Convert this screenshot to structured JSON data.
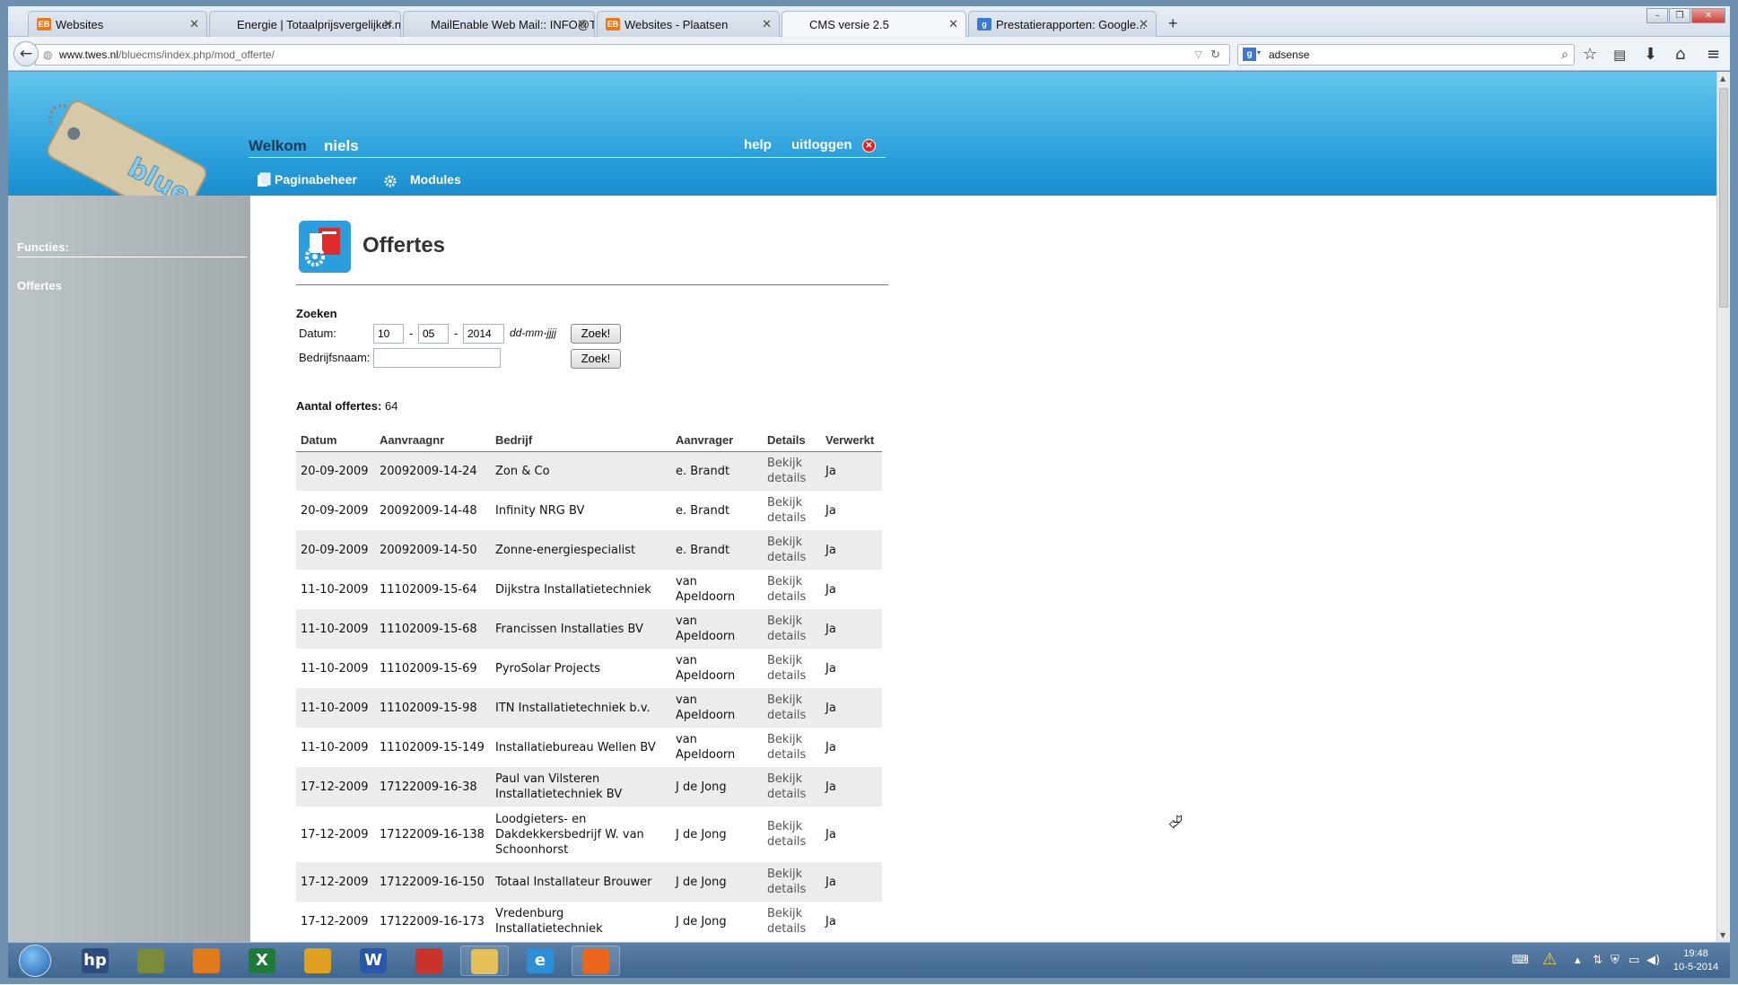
{
  "browser": {
    "tabs": [
      {
        "label": "Websites",
        "fav": "EB",
        "fav_color": "#e87a1d"
      },
      {
        "label": "Energie | Totaalprijsvergelijker.nl",
        "fav": "",
        "fav_color": ""
      },
      {
        "label": "MailEnable Web Mail:: INFO@T...",
        "fav": "",
        "fav_color": ""
      },
      {
        "label": "Websites - Plaatsen",
        "fav": "EB",
        "fav_color": "#e87a1d"
      },
      {
        "label": "CMS versie 2.5",
        "fav": "",
        "fav_color": ""
      },
      {
        "label": "Prestatierapporten: Google...",
        "fav": "g",
        "fav_color": "#3b79d7"
      }
    ],
    "new_tab_label": "+",
    "url_host": "www.twes.nl",
    "url_path": "/bluecms/index.php/mod_offerte/",
    "search_value": "adsense"
  },
  "header": {
    "welcome": "Welkom",
    "user": "niels",
    "help": "help",
    "logout": "uitloggen",
    "nav": [
      "Paginabeheer",
      "Modules"
    ]
  },
  "sidebar": {
    "heading": "Functies:",
    "items": [
      "Offertes"
    ]
  },
  "main": {
    "title": "Offertes",
    "search": {
      "heading": "Zoeken",
      "date_label": "Datum:",
      "day": "10",
      "month": "05",
      "year": "2014",
      "sep": "-",
      "format_hint": "dd-mm-jjjj",
      "button": "Zoek!",
      "company_label": "Bedrijfsnaam:",
      "company_value": ""
    },
    "count_label": "Aantal offertes:",
    "count_value": "64",
    "columns": [
      "Datum",
      "Aanvraagnr",
      "Bedrijf",
      "Aanvrager",
      "Details",
      "Verwerkt"
    ],
    "rows": [
      {
        "datum": "20-09-2009",
        "nr": "20092009-14-24",
        "bedrijf": "Zon & Co",
        "aanvrager": "e. Brandt",
        "details": "Bekijk details",
        "verwerkt": "Ja"
      },
      {
        "datum": "20-09-2009",
        "nr": "20092009-14-48",
        "bedrijf": "Infinity NRG BV",
        "aanvrager": "e. Brandt",
        "details": "Bekijk details",
        "verwerkt": "Ja"
      },
      {
        "datum": "20-09-2009",
        "nr": "20092009-14-50",
        "bedrijf": "Zonne-energiespecialist",
        "aanvrager": "e. Brandt",
        "details": "Bekijk details",
        "verwerkt": "Ja"
      },
      {
        "datum": "11-10-2009",
        "nr": "11102009-15-64",
        "bedrijf": "Dijkstra Installatietechniek",
        "aanvrager": "van Apeldoorn",
        "details": "Bekijk details",
        "verwerkt": "Ja"
      },
      {
        "datum": "11-10-2009",
        "nr": "11102009-15-68",
        "bedrijf": "Francissen Installaties BV",
        "aanvrager": "van Apeldoorn",
        "details": "Bekijk details",
        "verwerkt": "Ja"
      },
      {
        "datum": "11-10-2009",
        "nr": "11102009-15-69",
        "bedrijf": "PyroSolar Projects",
        "aanvrager": "van Apeldoorn",
        "details": "Bekijk details",
        "verwerkt": "Ja"
      },
      {
        "datum": "11-10-2009",
        "nr": "11102009-15-98",
        "bedrijf": "ITN Installatietechniek b.v.",
        "aanvrager": "van Apeldoorn",
        "details": "Bekijk details",
        "verwerkt": "Ja"
      },
      {
        "datum": "11-10-2009",
        "nr": "11102009-15-149",
        "bedrijf": "Installatiebureau Wellen BV",
        "aanvrager": "van Apeldoorn",
        "details": "Bekijk details",
        "verwerkt": "Ja"
      },
      {
        "datum": "17-12-2009",
        "nr": "17122009-16-38",
        "bedrijf": "Paul van Vilsteren Installatietechniek BV",
        "aanvrager": "J de Jong",
        "details": "Bekijk details",
        "verwerkt": "Ja"
      },
      {
        "datum": "17-12-2009",
        "nr": "17122009-16-138",
        "bedrijf": "Loodgieters- en Dakdekkersbedrijf W. van Schoonhorst",
        "aanvrager": "J de Jong",
        "details": "Bekijk details",
        "verwerkt": "Ja"
      },
      {
        "datum": "17-12-2009",
        "nr": "17122009-16-150",
        "bedrijf": "Totaal Installateur Brouwer",
        "aanvrager": "J de Jong",
        "details": "Bekijk details",
        "verwerkt": "Ja"
      },
      {
        "datum": "17-12-2009",
        "nr": "17122009-16-173",
        "bedrijf": "Vredenburg Installatietechniek",
        "aanvrager": "J de Jong",
        "details": "Bekijk details",
        "verwerkt": "Ja"
      }
    ]
  },
  "taskbar": {
    "apps": [
      "hp",
      "",
      "",
      "X",
      "",
      "W",
      "",
      "",
      "e",
      ""
    ],
    "time": "19:48",
    "date": "10-5-2014"
  },
  "colors": {
    "header_blue": "#2a9fdb",
    "sidebar_gray": "#a4acb0",
    "row_stripe": "#ececec"
  }
}
